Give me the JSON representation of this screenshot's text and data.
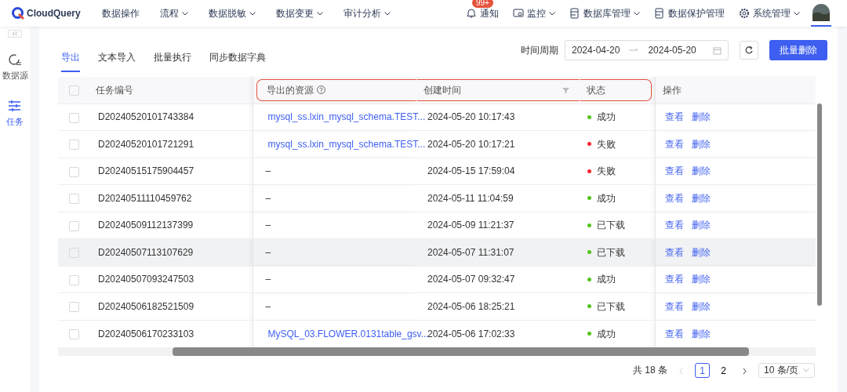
{
  "app": {
    "name": "CloudQuery"
  },
  "nav": [
    {
      "label": "数据操作",
      "dropdown": false
    },
    {
      "label": "流程",
      "dropdown": true
    },
    {
      "label": "数据脱敏",
      "dropdown": true
    },
    {
      "label": "数据变更",
      "dropdown": true
    },
    {
      "label": "审计分析",
      "dropdown": true
    }
  ],
  "right_nav": [
    {
      "kind": "bell",
      "label": "通知",
      "badge": "99+",
      "dropdown": false
    },
    {
      "kind": "monitor",
      "label": "监控",
      "dropdown": true
    },
    {
      "kind": "database",
      "label": "数据库管理",
      "dropdown": true
    },
    {
      "kind": "database",
      "label": "数据保护管理",
      "dropdown": false
    },
    {
      "kind": "gear",
      "label": "系统管理",
      "dropdown": true
    }
  ],
  "sidebar": {
    "items": [
      {
        "kind": "datasource",
        "label": "数据源",
        "selected": false
      },
      {
        "kind": "task",
        "label": "任务",
        "selected": true
      }
    ]
  },
  "tabs": [
    {
      "label": "导出",
      "selected": true
    },
    {
      "label": "文本导入",
      "selected": false
    },
    {
      "label": "批量执行",
      "selected": false
    },
    {
      "label": "同步数据字典",
      "selected": false
    }
  ],
  "filter": {
    "label": "时间周期",
    "start": "2024-04-20",
    "end": "2024-05-20"
  },
  "bulk_delete": "批量删除",
  "table": {
    "all_checked": false,
    "columns": [
      {
        "label": "任务编号",
        "outlined": false,
        "help": false,
        "filter": false
      },
      {
        "label": "导出的资源",
        "outlined": true,
        "help": true,
        "filter": false
      },
      {
        "label": "创建时间",
        "outlined": true,
        "help": false,
        "filter": true
      },
      {
        "label": "状态",
        "outlined": true,
        "help": false,
        "filter": false
      },
      {
        "label": "操作",
        "outlined": false,
        "help": false,
        "filter": false
      }
    ],
    "rows": [
      {
        "id": "D20240520101743384",
        "resource": {
          "kind": "link",
          "text": "mysql_ss.lxin_mysql_schema.TEST..."
        },
        "created": "2024-05-20 10:17:43",
        "status": "成功",
        "color": "#52c41a",
        "checked": false,
        "hovered": false,
        "actions": [
          "查看",
          "删除"
        ]
      },
      {
        "id": "D20240520101721291",
        "resource": {
          "kind": "link",
          "text": "mysql_ss.lxin_mysql_schema.TEST..."
        },
        "created": "2024-05-20 10:17:21",
        "status": "失败",
        "color": "#f5222d",
        "checked": false,
        "hovered": false,
        "actions": [
          "查看",
          "删除"
        ]
      },
      {
        "id": "D20240515175904457",
        "resource": {
          "kind": "plain",
          "text": "–"
        },
        "created": "2024-05-15 17:59:04",
        "status": "失败",
        "color": "#f5222d",
        "checked": false,
        "hovered": false,
        "actions": [
          "查看",
          "删除"
        ]
      },
      {
        "id": "D20240511110459762",
        "resource": {
          "kind": "plain",
          "text": "–"
        },
        "created": "2024-05-11 11:04:59",
        "status": "成功",
        "color": "#52c41a",
        "checked": false,
        "hovered": false,
        "actions": [
          "查看",
          "删除"
        ]
      },
      {
        "id": "D20240509112137399",
        "resource": {
          "kind": "plain",
          "text": "–"
        },
        "created": "2024-05-09 11:21:37",
        "status": "已下载",
        "color": "#52c41a",
        "checked": false,
        "hovered": false,
        "actions": [
          "查看",
          "删除"
        ]
      },
      {
        "id": "D20240507113107629",
        "resource": {
          "kind": "plain",
          "text": "–"
        },
        "created": "2024-05-07 11:31:07",
        "status": "已下载",
        "color": "#52c41a",
        "checked": false,
        "hovered": true,
        "actions": [
          "查看",
          "删除"
        ]
      },
      {
        "id": "D20240507093247503",
        "resource": {
          "kind": "plain",
          "text": "–"
        },
        "created": "2024-05-07 09:32:47",
        "status": "成功",
        "color": "#52c41a",
        "checked": false,
        "hovered": false,
        "actions": [
          "查看",
          "删除"
        ]
      },
      {
        "id": "D20240506182521509",
        "resource": {
          "kind": "plain",
          "text": "–"
        },
        "created": "2024-05-06 18:25:21",
        "status": "已下载",
        "color": "#52c41a",
        "checked": false,
        "hovered": false,
        "actions": [
          "查看",
          "删除"
        ]
      },
      {
        "id": "D20240506170233103",
        "resource": {
          "kind": "link",
          "text": "MySQL_03.FLOWER.0131table_gsv..."
        },
        "created": "2024-05-06 17:02:33",
        "status": "成功",
        "color": "#52c41a",
        "checked": false,
        "hovered": false,
        "actions": [
          "查看",
          "删除"
        ]
      }
    ]
  },
  "pagination": {
    "total": "共 18 条",
    "pages": [
      {
        "label": "1",
        "selected": true
      },
      {
        "label": "2",
        "selected": false
      }
    ],
    "page_size": "10 条/页"
  }
}
